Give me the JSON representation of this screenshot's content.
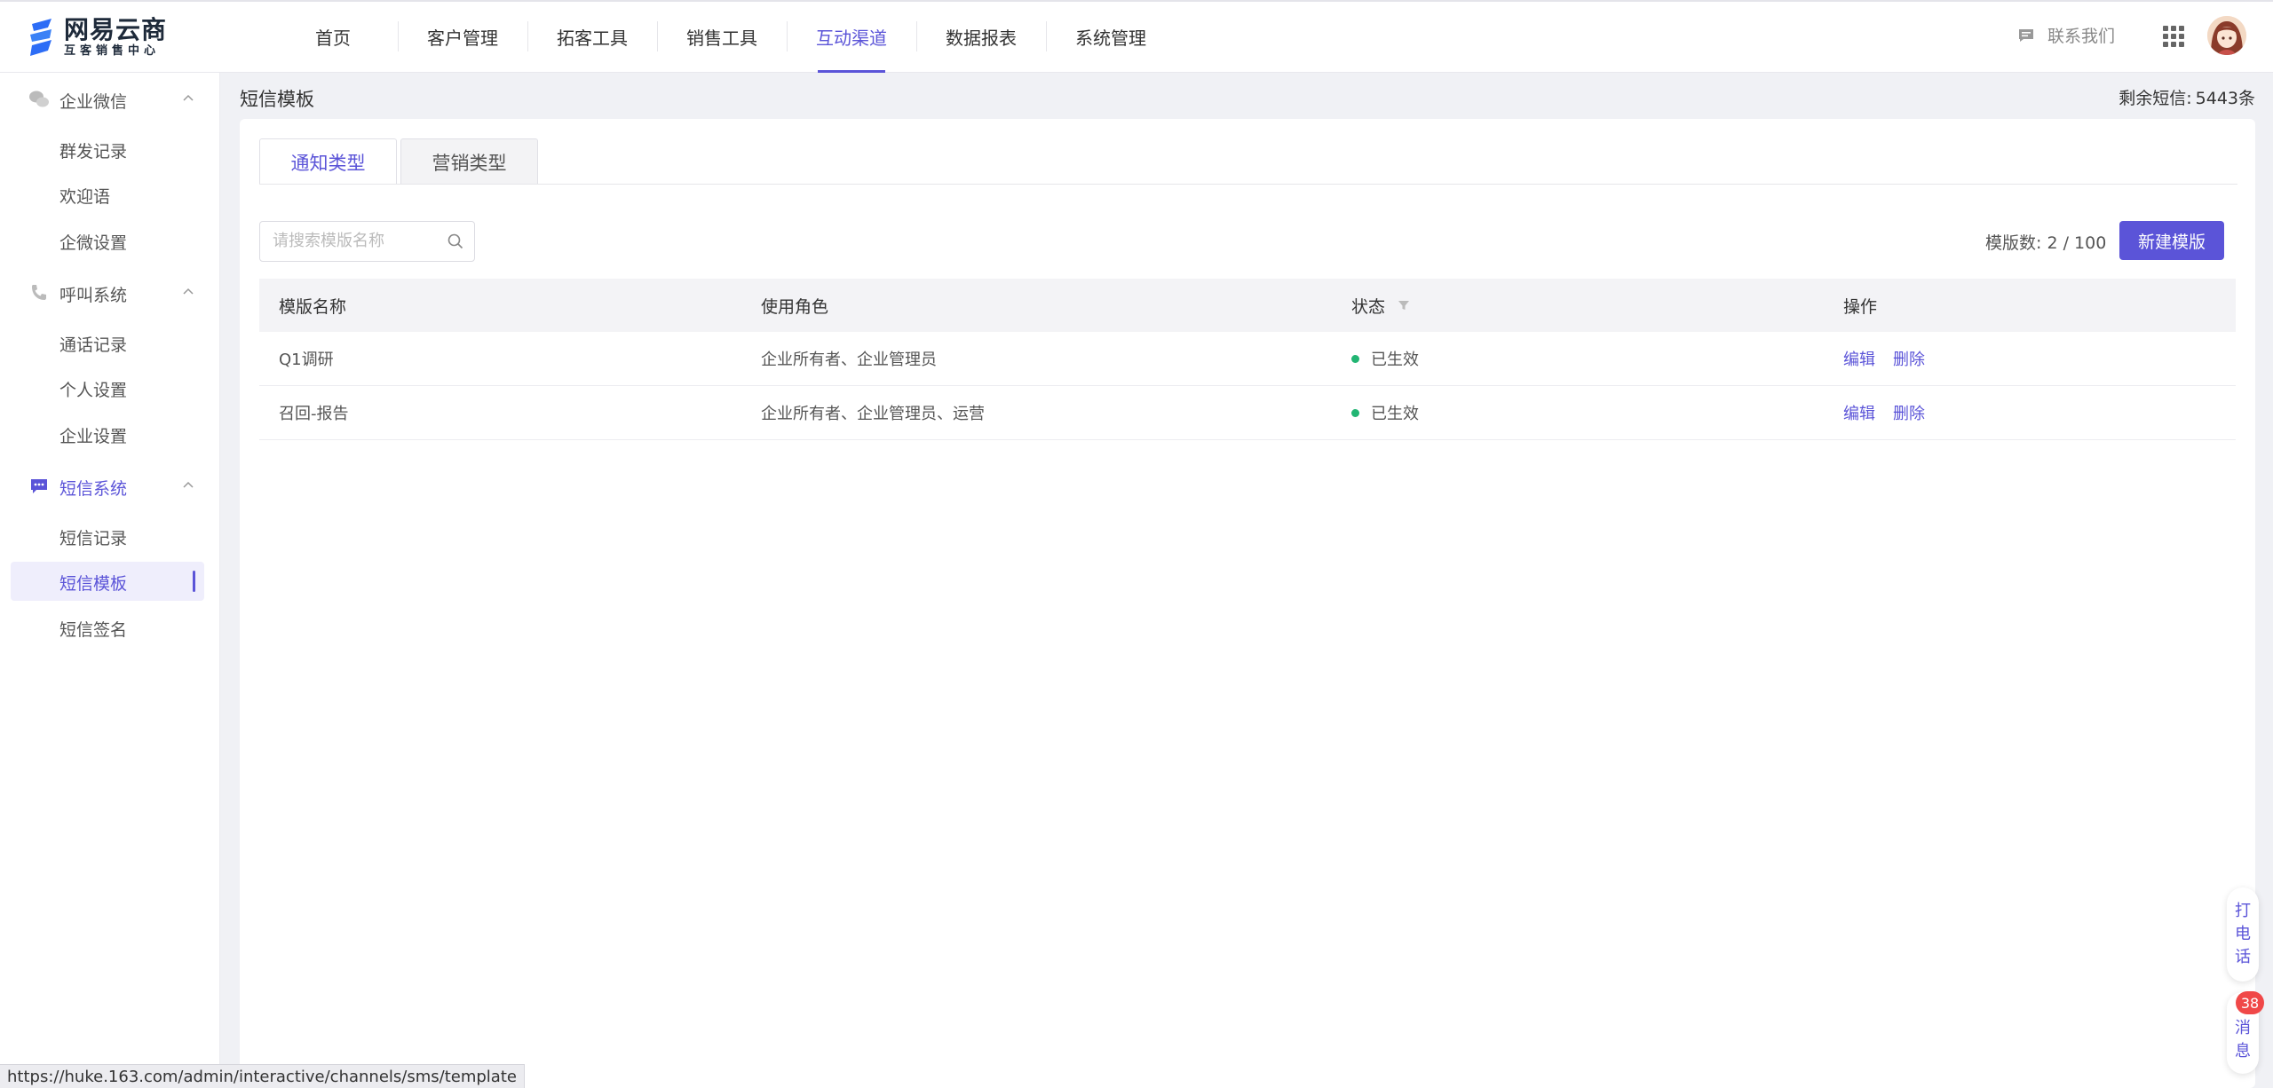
{
  "logo": {
    "title": "网易云商",
    "subtitle": "互客销售中心"
  },
  "nav": [
    {
      "label": "首页"
    },
    {
      "label": "客户管理"
    },
    {
      "label": "拓客工具"
    },
    {
      "label": "销售工具"
    },
    {
      "label": "互动渠道",
      "active": true
    },
    {
      "label": "数据报表"
    },
    {
      "label": "系统管理"
    }
  ],
  "header": {
    "contact_label": "联系我们",
    "contact_icon": "chat-icon",
    "apps_icon": "grid-apps-icon"
  },
  "sidebar": {
    "groups": [
      {
        "label": "企业微信",
        "icon": "wechat-bubbles-icon",
        "items": [
          "群发记录",
          "欢迎语",
          "企微设置"
        ]
      },
      {
        "label": "呼叫系统",
        "icon": "phone-icon",
        "items": [
          "通话记录",
          "个人设置",
          "企业设置"
        ]
      },
      {
        "label": "短信系统",
        "icon": "sms-icon",
        "active": true,
        "items": [
          "短信记录",
          "短信模板",
          "短信签名"
        ],
        "active_item": "短信模板"
      }
    ]
  },
  "page": {
    "title": "短信模板",
    "remain_label": "剩余短信:",
    "remain_value": "5443条"
  },
  "tabs": [
    {
      "label": "通知类型",
      "active": true
    },
    {
      "label": "营销类型"
    }
  ],
  "toolbar": {
    "search_placeholder": "请搜索模版名称",
    "count_label": "模版数:",
    "count_value": "2 / 100",
    "new_button": "新建模版"
  },
  "table": {
    "headers": [
      "模版名称",
      "使用角色",
      "状态",
      "操作"
    ],
    "rows": [
      {
        "name": "Q1调研",
        "roles": "企业所有者、企业管理员",
        "status": "已生效",
        "actions": [
          "编辑",
          "删除"
        ]
      },
      {
        "name": "召回-报告",
        "roles": "企业所有者、企业管理员、运营",
        "status": "已生效",
        "actions": [
          "编辑",
          "删除"
        ]
      }
    ]
  },
  "floating": {
    "call": [
      "打",
      "电",
      "话"
    ],
    "message": [
      "消",
      "息"
    ],
    "message_badge": "38"
  },
  "statusbar": {
    "url": "https://huke.163.com/admin/interactive/channels/sms/template"
  },
  "colors": {
    "accent": "#5b54d8",
    "success": "#22b573",
    "badge": "#f04848"
  }
}
